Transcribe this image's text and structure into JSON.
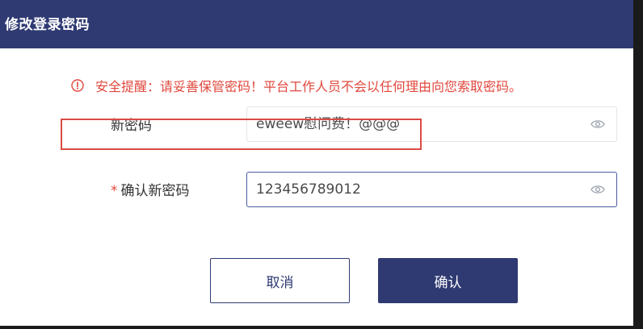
{
  "dialog": {
    "title": "修改登录密码"
  },
  "warning": {
    "icon": "info-circle-icon",
    "text": "安全提醒：请妥善保管密码！平台工作人员不会以任何理由向您索取密码。",
    "color": "#e0483e"
  },
  "form": {
    "new_password": {
      "label": "新密码",
      "value": "eweew慰问费！@@@",
      "icon": "eye-icon"
    },
    "confirm_password": {
      "required_mark": "*",
      "label": "确认新密码",
      "value": "123456789012",
      "icon": "eye-icon"
    }
  },
  "buttons": {
    "cancel_label": "取消",
    "confirm_label": "确认"
  },
  "colors": {
    "primary": "#2f3a72",
    "danger": "#e0483e"
  }
}
